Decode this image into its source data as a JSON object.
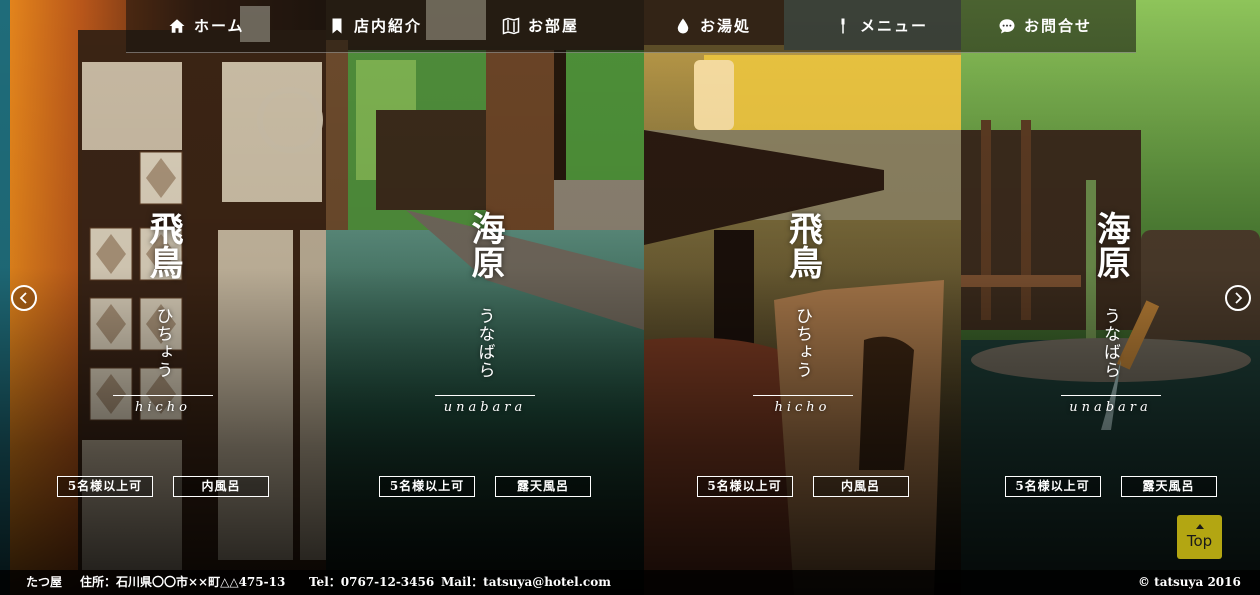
{
  "nav": {
    "items": [
      {
        "label": "ホーム",
        "icon": "home-icon"
      },
      {
        "label": "店内紹介",
        "icon": "bookmark-icon"
      },
      {
        "label": "お部屋",
        "icon": "map-icon"
      },
      {
        "label": "お湯処",
        "icon": "drop-icon"
      },
      {
        "label": "メニュー",
        "icon": "fork-icon"
      },
      {
        "label": "お問合せ",
        "icon": "chat-bubble-icon"
      }
    ]
  },
  "rooms": [
    {
      "kanji": "飛鳥",
      "kana": "ひちょう",
      "roman": "hicho",
      "tags": [
        "5名様以上可",
        "内風呂"
      ]
    },
    {
      "kanji": "海原",
      "kana": "うなばら",
      "roman": "unabara",
      "tags": [
        "5名様以上可",
        "露天風呂"
      ]
    },
    {
      "kanji": "飛鳥",
      "kana": "ひちょう",
      "roman": "hicho",
      "tags": [
        "5名様以上可",
        "内風呂"
      ]
    },
    {
      "kanji": "海原",
      "kana": "うなばら",
      "roman": "unabara",
      "tags": [
        "5名様以上可",
        "露天風呂"
      ]
    }
  ],
  "top_button": {
    "label": "Top"
  },
  "footer": {
    "name": "たつ屋",
    "address": "住所：石川県〇〇市××町△△475-13",
    "tel": "Tel：0767-12-3456",
    "mail": "Mail：tatsuya@hotel.com",
    "copyright": "© tatsuya 2016"
  },
  "colors": {
    "top_button": "#b3a612",
    "accent": "#ffffff"
  }
}
